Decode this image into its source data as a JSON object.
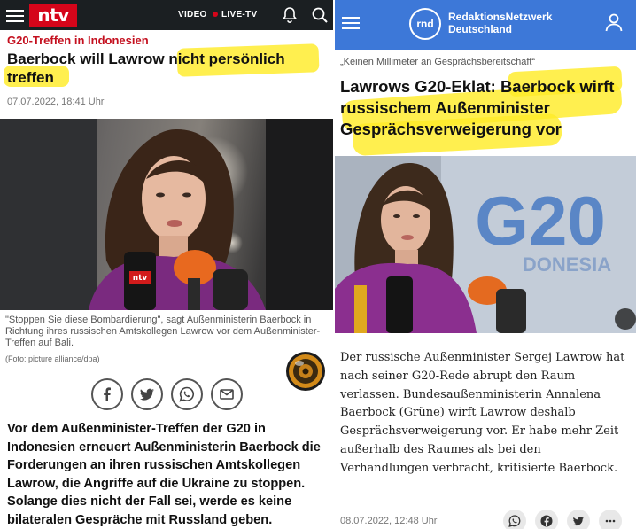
{
  "ntv": {
    "logo": "ntv",
    "nav": {
      "video": "VIDEO",
      "live": "LIVE-TV"
    },
    "kicker": "G20-Treffen in Indonesien",
    "headline": "Baerbock will Lawrow nicht persönlich treffen",
    "date": "07.07.2022, 18:41 Uhr",
    "caption": "\"Stoppen Sie diese Bombardierung\", sagt Außenministerin Baerbock in Richtung ihres russischen Amtskollegen Lawrow vor dem Außenminister-Treffen auf Bali.",
    "credit": "(Foto: picture alliance/dpa)",
    "mic_label": "ntv",
    "body": "Vor dem Außenminister-Treffen der G20 in Indonesien erneuert Außenministerin Baerbock die Forderungen an ihren russischen Amtskollegen Lawrow, die Angriffe auf die Ukraine zu stoppen. Solange dies nicht der Fall sei, werde es keine bilateralen Gespräche mit Russland geben.",
    "colors": {
      "header": "#1b1f22",
      "brand_red": "#d5051a",
      "kicker_red": "#c4101f"
    },
    "icons": [
      "menu-icon",
      "bell-icon",
      "search-icon",
      "zoom-icon",
      "facebook-icon",
      "twitter-icon",
      "whatsapp-icon",
      "mail-icon",
      "speaker-icon"
    ]
  },
  "rnd": {
    "logo": "rnd",
    "brand_line1": "RedaktionsNetzwerk",
    "brand_line2": "Deutschland",
    "kicker": "„Keinen Millimeter an Gesprächsbereitschaft“",
    "headline": "Lawrows G20-Eklat: Baerbock wirft russischem Außenminister Gesprächsverweigerung vor",
    "photo_text": "G20",
    "photo_subtext": "DONESIA",
    "body": "Der russische Außenminister Sergej Lawrow hat nach seiner G20-Rede abrupt den Raum verlassen. Bundesaußenministerin Annalena Baerbock (Grüne) wirft Lawrow deshalb Gesprächsverweigerung vor. Er habe mehr Zeit außerhalb des Raumes als bei den Verhandlungen verbracht, kritisierte Baerbock.",
    "date": "08.07.2022, 12:48 Uhr",
    "colors": {
      "header": "#3d78d8",
      "highlight": "#ffec28"
    },
    "icons": [
      "menu-icon",
      "user-icon",
      "whatsapp-icon",
      "facebook-icon",
      "twitter-icon",
      "more-icon"
    ]
  }
}
